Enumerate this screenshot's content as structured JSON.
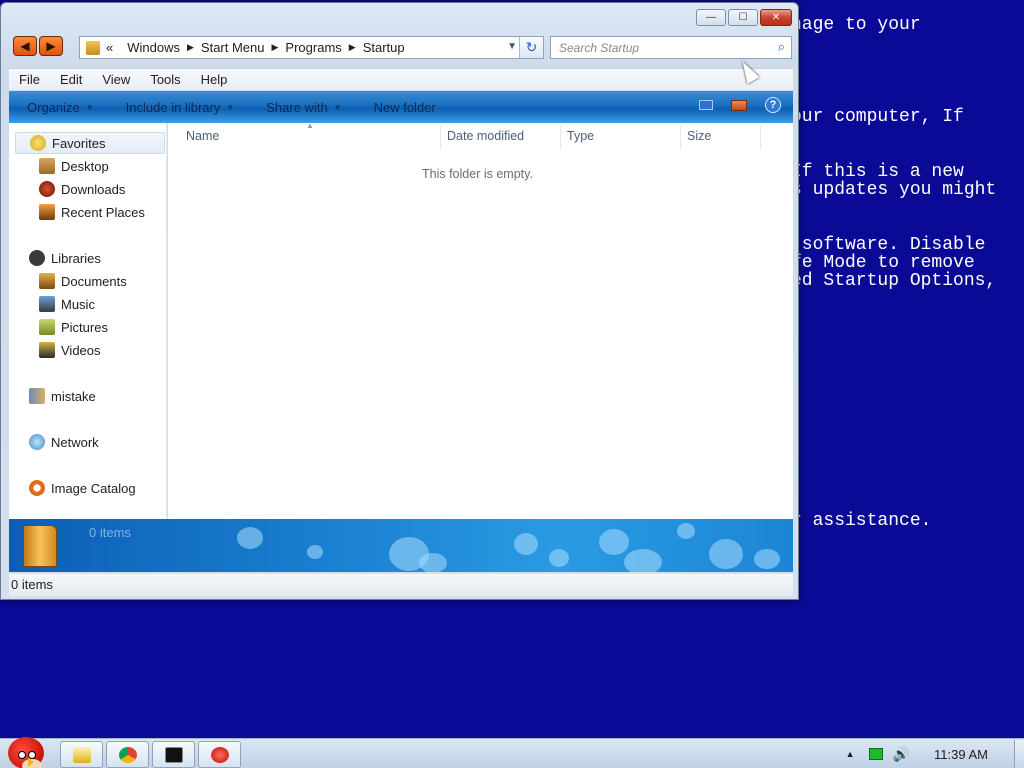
{
  "bsod": {
    "lines": [
      "nage to your",
      "our computer, If",
      "If this is a new",
      "s updates you might",
      " software. Disable",
      "fe Mode to remove",
      "ed Startup Options,",
      "r assistance."
    ]
  },
  "window": {
    "caption": {
      "minimize": "—",
      "maximize": "☐",
      "close": "✕"
    },
    "nav": {
      "back": "◀",
      "forward": "▶"
    },
    "address": {
      "prefix": "«",
      "crumbs": [
        "Windows",
        "Start Menu",
        "Programs",
        "Startup"
      ],
      "separator": "▶",
      "dropdown": "▼",
      "refresh": "↻"
    },
    "search": {
      "placeholder": "Search Startup",
      "icon": "⌕"
    },
    "menu": [
      "File",
      "Edit",
      "View",
      "Tools",
      "Help"
    ],
    "commands": {
      "organize": "Organize",
      "include": "Include in library",
      "share": "Share with",
      "new_folder": "New folder",
      "help": "?"
    },
    "nav_pane": {
      "favorites": "Favorites",
      "desktop": "Desktop",
      "downloads": "Downloads",
      "recent": "Recent Places",
      "libraries": "Libraries",
      "documents": "Documents",
      "music": "Music",
      "pictures": "Pictures",
      "videos": "Videos",
      "homegroup": "mistake",
      "network": "Network",
      "image_catalog": "Image Catalog"
    },
    "columns": {
      "name": "Name",
      "date": "Date modified",
      "type": "Type",
      "size": "Size"
    },
    "empty_message": "This folder is empty.",
    "details": {
      "count": "0 items"
    },
    "status": {
      "count": "0 items"
    }
  },
  "taskbar": {
    "clock": "11:39 AM",
    "tray_arrow": "▲",
    "volume": "🔊"
  },
  "colors": {
    "desktop_bg": "#0a0a96",
    "command_bar": "#1a6ec0",
    "accent_orange": "#e2520c"
  }
}
